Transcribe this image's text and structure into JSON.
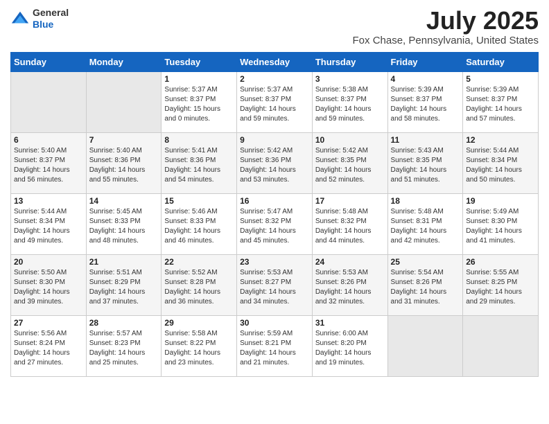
{
  "logo": {
    "general": "General",
    "blue": "Blue"
  },
  "title": "July 2025",
  "subtitle": "Fox Chase, Pennsylvania, United States",
  "days_of_week": [
    "Sunday",
    "Monday",
    "Tuesday",
    "Wednesday",
    "Thursday",
    "Friday",
    "Saturday"
  ],
  "weeks": [
    [
      {
        "day": "",
        "info": ""
      },
      {
        "day": "",
        "info": ""
      },
      {
        "day": "1",
        "info": "Sunrise: 5:37 AM\nSunset: 8:37 PM\nDaylight: 15 hours and 0 minutes."
      },
      {
        "day": "2",
        "info": "Sunrise: 5:37 AM\nSunset: 8:37 PM\nDaylight: 14 hours and 59 minutes."
      },
      {
        "day": "3",
        "info": "Sunrise: 5:38 AM\nSunset: 8:37 PM\nDaylight: 14 hours and 59 minutes."
      },
      {
        "day": "4",
        "info": "Sunrise: 5:39 AM\nSunset: 8:37 PM\nDaylight: 14 hours and 58 minutes."
      },
      {
        "day": "5",
        "info": "Sunrise: 5:39 AM\nSunset: 8:37 PM\nDaylight: 14 hours and 57 minutes."
      }
    ],
    [
      {
        "day": "6",
        "info": "Sunrise: 5:40 AM\nSunset: 8:37 PM\nDaylight: 14 hours and 56 minutes."
      },
      {
        "day": "7",
        "info": "Sunrise: 5:40 AM\nSunset: 8:36 PM\nDaylight: 14 hours and 55 minutes."
      },
      {
        "day": "8",
        "info": "Sunrise: 5:41 AM\nSunset: 8:36 PM\nDaylight: 14 hours and 54 minutes."
      },
      {
        "day": "9",
        "info": "Sunrise: 5:42 AM\nSunset: 8:36 PM\nDaylight: 14 hours and 53 minutes."
      },
      {
        "day": "10",
        "info": "Sunrise: 5:42 AM\nSunset: 8:35 PM\nDaylight: 14 hours and 52 minutes."
      },
      {
        "day": "11",
        "info": "Sunrise: 5:43 AM\nSunset: 8:35 PM\nDaylight: 14 hours and 51 minutes."
      },
      {
        "day": "12",
        "info": "Sunrise: 5:44 AM\nSunset: 8:34 PM\nDaylight: 14 hours and 50 minutes."
      }
    ],
    [
      {
        "day": "13",
        "info": "Sunrise: 5:44 AM\nSunset: 8:34 PM\nDaylight: 14 hours and 49 minutes."
      },
      {
        "day": "14",
        "info": "Sunrise: 5:45 AM\nSunset: 8:33 PM\nDaylight: 14 hours and 48 minutes."
      },
      {
        "day": "15",
        "info": "Sunrise: 5:46 AM\nSunset: 8:33 PM\nDaylight: 14 hours and 46 minutes."
      },
      {
        "day": "16",
        "info": "Sunrise: 5:47 AM\nSunset: 8:32 PM\nDaylight: 14 hours and 45 minutes."
      },
      {
        "day": "17",
        "info": "Sunrise: 5:48 AM\nSunset: 8:32 PM\nDaylight: 14 hours and 44 minutes."
      },
      {
        "day": "18",
        "info": "Sunrise: 5:48 AM\nSunset: 8:31 PM\nDaylight: 14 hours and 42 minutes."
      },
      {
        "day": "19",
        "info": "Sunrise: 5:49 AM\nSunset: 8:30 PM\nDaylight: 14 hours and 41 minutes."
      }
    ],
    [
      {
        "day": "20",
        "info": "Sunrise: 5:50 AM\nSunset: 8:30 PM\nDaylight: 14 hours and 39 minutes."
      },
      {
        "day": "21",
        "info": "Sunrise: 5:51 AM\nSunset: 8:29 PM\nDaylight: 14 hours and 37 minutes."
      },
      {
        "day": "22",
        "info": "Sunrise: 5:52 AM\nSunset: 8:28 PM\nDaylight: 14 hours and 36 minutes."
      },
      {
        "day": "23",
        "info": "Sunrise: 5:53 AM\nSunset: 8:27 PM\nDaylight: 14 hours and 34 minutes."
      },
      {
        "day": "24",
        "info": "Sunrise: 5:53 AM\nSunset: 8:26 PM\nDaylight: 14 hours and 32 minutes."
      },
      {
        "day": "25",
        "info": "Sunrise: 5:54 AM\nSunset: 8:26 PM\nDaylight: 14 hours and 31 minutes."
      },
      {
        "day": "26",
        "info": "Sunrise: 5:55 AM\nSunset: 8:25 PM\nDaylight: 14 hours and 29 minutes."
      }
    ],
    [
      {
        "day": "27",
        "info": "Sunrise: 5:56 AM\nSunset: 8:24 PM\nDaylight: 14 hours and 27 minutes."
      },
      {
        "day": "28",
        "info": "Sunrise: 5:57 AM\nSunset: 8:23 PM\nDaylight: 14 hours and 25 minutes."
      },
      {
        "day": "29",
        "info": "Sunrise: 5:58 AM\nSunset: 8:22 PM\nDaylight: 14 hours and 23 minutes."
      },
      {
        "day": "30",
        "info": "Sunrise: 5:59 AM\nSunset: 8:21 PM\nDaylight: 14 hours and 21 minutes."
      },
      {
        "day": "31",
        "info": "Sunrise: 6:00 AM\nSunset: 8:20 PM\nDaylight: 14 hours and 19 minutes."
      },
      {
        "day": "",
        "info": ""
      },
      {
        "day": "",
        "info": ""
      }
    ]
  ]
}
